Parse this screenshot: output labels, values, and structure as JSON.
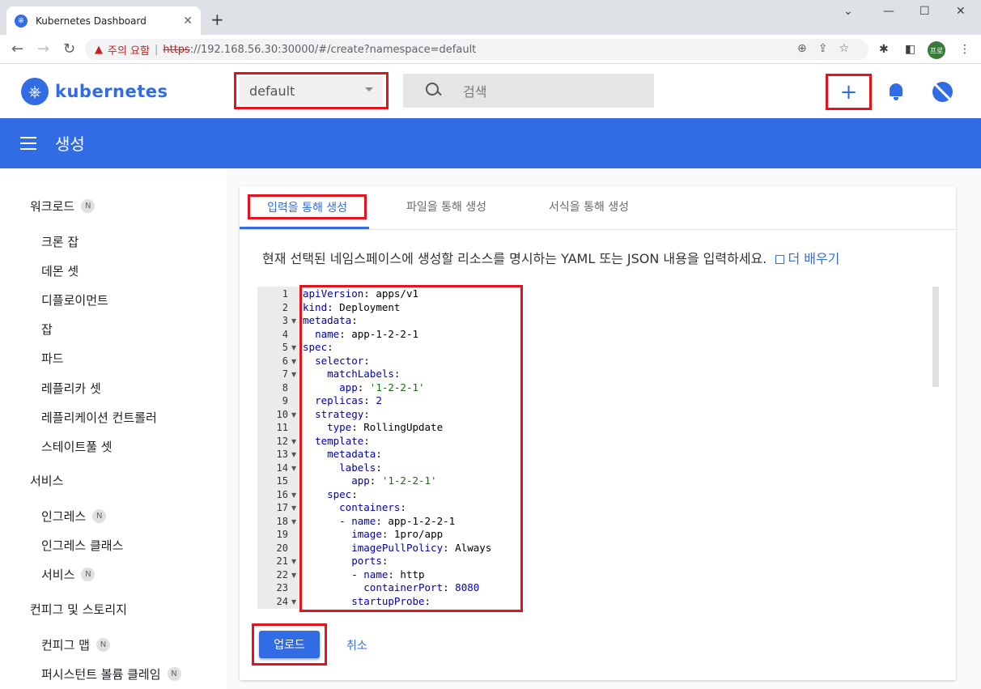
{
  "browser": {
    "tab_title": "Kubernetes Dashboard",
    "url_warning": "주의 요함",
    "url_scheme": "https",
    "url_rest": "://192.168.56.30:30000/#/create?namespace=default",
    "profile": "프로"
  },
  "header": {
    "logo_text": "kubernetes",
    "namespace": "default",
    "search_placeholder": "검색"
  },
  "toolbar": {
    "title": "생성"
  },
  "sidebar": {
    "sections": [
      {
        "label": "워크로드",
        "badge": "N"
      },
      {
        "label": "서비스"
      },
      {
        "label": "컨피그 및 스토리지"
      }
    ],
    "workload_items": [
      "크론 잡",
      "데몬 셋",
      "디플로이먼트",
      "잡",
      "파드",
      "레플리카 셋",
      "레플리케이션 컨트롤러",
      "스테이트풀 셋"
    ],
    "service_items": [
      {
        "label": "인그레스",
        "badge": "N"
      },
      {
        "label": "인그레스 클래스"
      },
      {
        "label": "서비스",
        "badge": "N"
      }
    ],
    "config_items": [
      {
        "label": "컨피그 맵",
        "badge": "N"
      },
      {
        "label": "퍼시스턴트 볼륨 클레임",
        "badge": "N"
      }
    ]
  },
  "create": {
    "tabs": [
      "입력을 통해 생성",
      "파일을 통해 생성",
      "서식을 통해 생성"
    ],
    "instruction": "현재 선택된 네임스페이스에 생성할 리소스를 명시하는 YAML 또는 JSON 내용을 입력하세요.",
    "learn_more": "더 배우기",
    "upload": "업로드",
    "cancel": "취소"
  },
  "editor": {
    "line_numbers": [
      "1",
      "2",
      "3",
      "4",
      "5",
      "6",
      "7",
      "8",
      "9",
      "10",
      "11",
      "12",
      "13",
      "14",
      "15",
      "16",
      "17",
      "18",
      "19",
      "20",
      "21",
      "22",
      "23",
      "24"
    ],
    "lines": [
      "apiVersion: apps/v1",
      "kind: Deployment",
      "metadata:",
      "  name: app-1-2-2-1",
      "spec:",
      "  selector:",
      "    matchLabels:",
      "      app: '1-2-2-1'",
      "  replicas: 2",
      "  strategy:",
      "    type: RollingUpdate",
      "  template:",
      "    metadata:",
      "      labels:",
      "        app: '1-2-2-1'",
      "    spec:",
      "      containers:",
      "      - name: app-1-2-2-1",
      "        image: 1pro/app",
      "        imagePullPolicy: Always",
      "        ports:",
      "        - name: http",
      "          containerPort: 8080",
      "        startupProbe:"
    ]
  },
  "colors": {
    "accent": "#326ce5",
    "highlight": "#e3141c"
  }
}
